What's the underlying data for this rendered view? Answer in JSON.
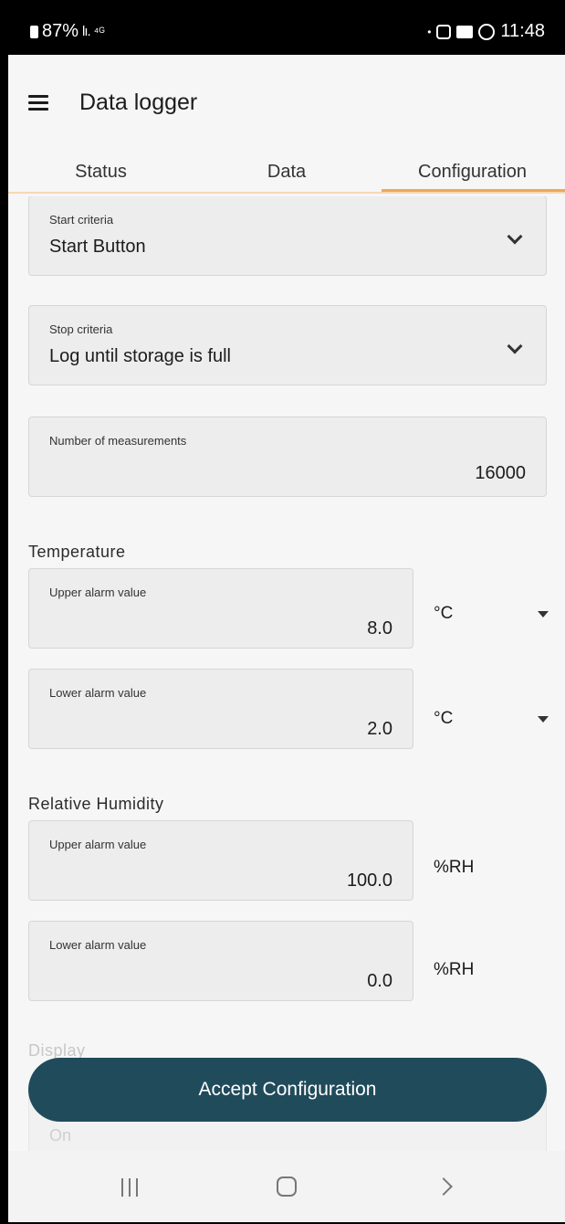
{
  "status_bar": {
    "battery": "87%",
    "time": "11:48",
    "signal": "lı.",
    "wifi": "⁴ᴳ",
    "dot": "•"
  },
  "app_bar": {
    "title": "Data logger"
  },
  "tabs": [
    {
      "label": "Status"
    },
    {
      "label": "Data"
    },
    {
      "label": "Configuration",
      "active": true
    }
  ],
  "start_criteria": {
    "label": "Start criteria",
    "value": "Start Button"
  },
  "stop_criteria": {
    "label": "Stop criteria",
    "value": "Log until storage is full"
  },
  "measurements": {
    "label": "Number of measurements",
    "value": "16000"
  },
  "temperature": {
    "title": "Temperature",
    "upper": {
      "label": "Upper alarm value",
      "value": "8.0",
      "unit": "°C"
    },
    "lower": {
      "label": "Lower alarm value",
      "value": "2.0",
      "unit": "°C"
    }
  },
  "humidity": {
    "title": "Relative Humidity",
    "upper": {
      "label": "Upper alarm value",
      "value": "100.0",
      "unit": "%RH"
    },
    "lower": {
      "label": "Lower alarm value",
      "value": "0.0",
      "unit": "%RH"
    }
  },
  "display": {
    "title": "Display",
    "value": "On"
  },
  "accept_button": {
    "label": "Accept Configuration"
  },
  "colors": {
    "accent_tab": "#f2a65a",
    "button_bg": "#204b5b"
  }
}
